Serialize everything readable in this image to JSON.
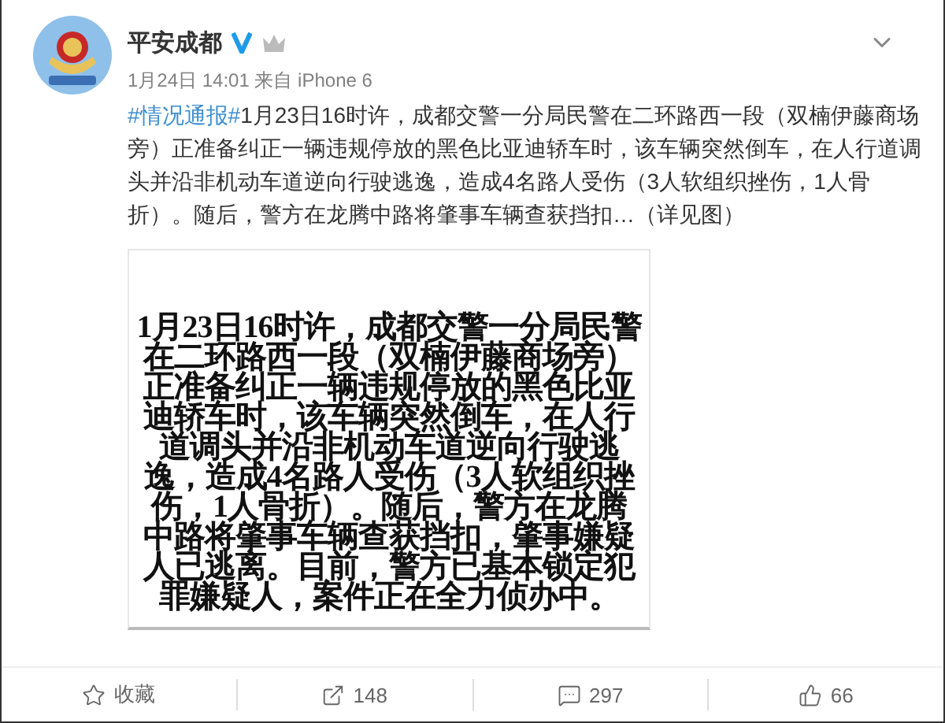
{
  "account": {
    "name": "平安成都",
    "verified": true,
    "member": true
  },
  "meta": "1月24日 14:01 来自 iPhone 6",
  "post": {
    "hashtag": "#情况通报#",
    "text": "1月23日16时许，成都交警一分局民警在二环路西一段（双楠伊藤商场旁）正准备纠正一辆违规停放的黑色比亚迪轿车时，该车辆突然倒车，在人行道调头并沿非机动车道逆向行驶逃逸，造成4名路人受伤（3人软组织挫伤，1人骨折）。随后，警方在龙腾中路将肇事车辆查获挡扣…（详见图）"
  },
  "image": {
    "lines": [
      "1月23日16时许，成都交警一分局民警",
      "在二环路西一段（双楠伊藤商场旁）",
      "正准备纠正一辆违规停放的黑色比亚",
      "迪轿车时，该车辆突然倒车，在人行",
      "道调头并沿非机动车道逆向行驶逃",
      "逸，造成4名路人受伤（3人软组织挫",
      "伤，1人骨折）。随后，警方在龙腾",
      "中路将肇事车辆查获挡扣，肇事嫌疑",
      "人已逃离。目前，警方已基本锁定犯",
      "罪嫌疑人，案件正在全力侦办中。"
    ]
  },
  "actions": [
    {
      "kind": "favorite",
      "label": "收藏"
    },
    {
      "kind": "repost",
      "label": "148"
    },
    {
      "kind": "comment",
      "label": "297"
    },
    {
      "kind": "like",
      "label": "66"
    }
  ]
}
